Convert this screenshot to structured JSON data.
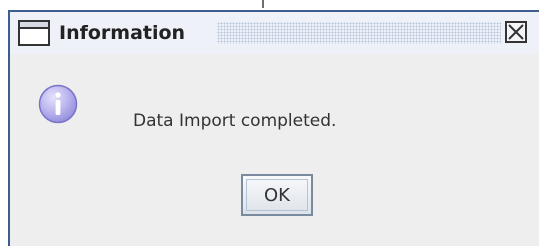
{
  "dialog": {
    "title": "Information",
    "title_icon": "window-icon",
    "close_icon": "close-icon",
    "message_icon": "info-icon",
    "message": "Data Import completed.",
    "ok_label": "OK"
  },
  "colors": {
    "border": "#3c5d8e",
    "titlebar": "#eef2f8",
    "content_bg": "#eeeeee",
    "info_icon": "#a9a4e6"
  }
}
